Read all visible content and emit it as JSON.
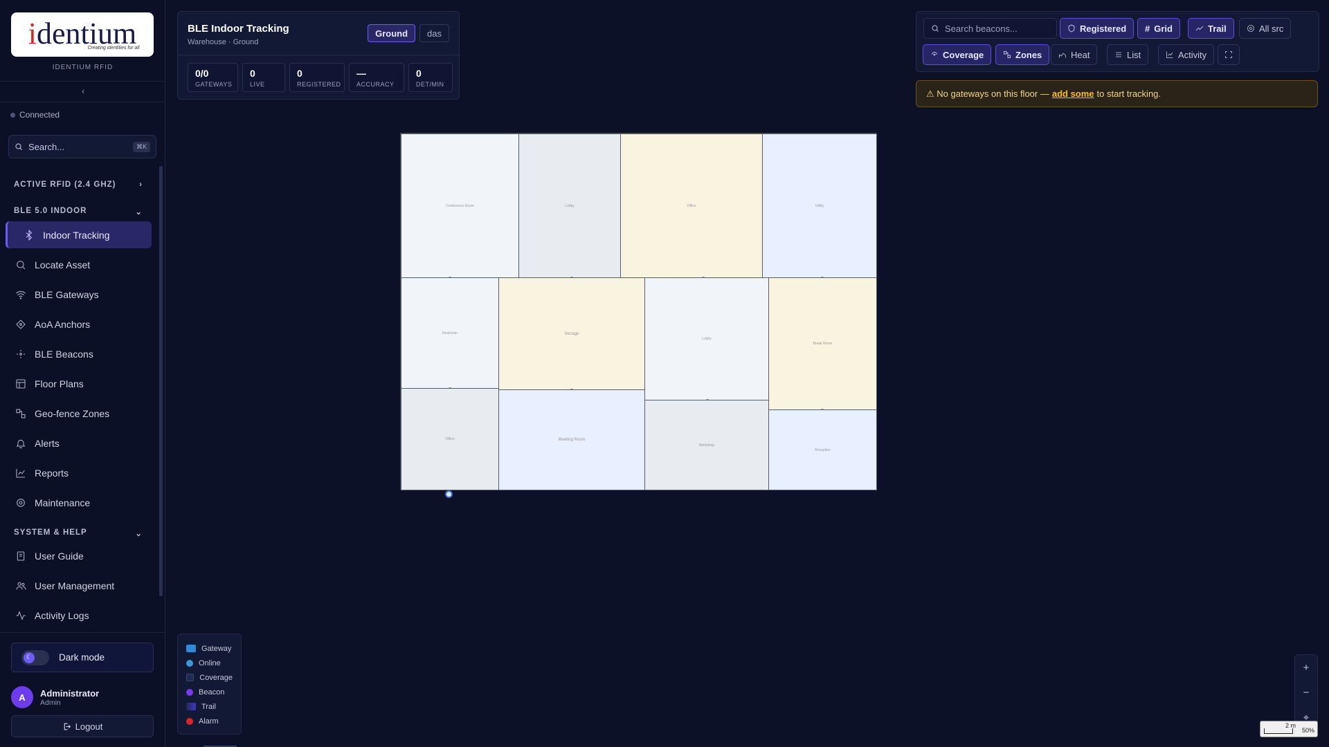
{
  "brand": {
    "logo_text": "identium",
    "logo_tagline": "Creating identities for all",
    "name": "IDENTIUM RFID"
  },
  "sidebar": {
    "connection": "Connected",
    "search_placeholder": "Search...",
    "search_shortcut": "⌘K",
    "sections": [
      {
        "label": "ACTIVE RFID (2.4 GHZ)"
      },
      {
        "label": "BLE 5.0 INDOOR"
      },
      {
        "label": "SYSTEM & HELP"
      }
    ],
    "items": [
      {
        "label": "Indoor Tracking",
        "icon": "bluetooth-icon"
      },
      {
        "label": "Locate Asset",
        "icon": "search-icon"
      },
      {
        "label": "BLE Gateways",
        "icon": "wifi-icon"
      },
      {
        "label": "AoA Anchors",
        "icon": "diamond-icon"
      },
      {
        "label": "BLE Beacons",
        "icon": "beacon-icon"
      },
      {
        "label": "Floor Plans",
        "icon": "layout-icon"
      },
      {
        "label": "Geo-fence Zones",
        "icon": "zones-icon"
      },
      {
        "label": "Alerts",
        "icon": "bell-icon"
      },
      {
        "label": "Reports",
        "icon": "chart-icon"
      },
      {
        "label": "Maintenance",
        "icon": "gear-icon"
      },
      {
        "label": "User Guide",
        "icon": "book-icon"
      },
      {
        "label": "User Management",
        "icon": "users-icon"
      },
      {
        "label": "Activity Logs",
        "icon": "activity-icon"
      }
    ],
    "dark_mode_label": "Dark mode",
    "user": {
      "initial": "A",
      "name": "Administrator",
      "role": "Admin"
    },
    "logout_label": "Logout"
  },
  "header": {
    "title": "BLE Indoor Tracking",
    "subtitle": "Warehouse · Ground",
    "floors": [
      "Ground",
      "das"
    ],
    "stats": [
      {
        "value": "0/0",
        "label": "GATEWAYS"
      },
      {
        "value": "0",
        "label": "LIVE"
      },
      {
        "value": "0",
        "label": "REGISTERED"
      },
      {
        "value": "—",
        "label": "ACCURACY"
      },
      {
        "value": "0",
        "label": "DET/MIN"
      }
    ]
  },
  "toolbar": {
    "search_placeholder": "Search beacons...",
    "buttons": [
      {
        "label": "Registered",
        "icon": "shield-icon",
        "active": true
      },
      {
        "label": "Grid",
        "icon": "hash-icon",
        "active": true
      },
      {
        "label": "Trail",
        "icon": "trail-icon",
        "active": true
      },
      {
        "label": "All src",
        "icon": "target-icon",
        "active": false
      },
      {
        "label": "Coverage",
        "icon": "coverage-icon",
        "active": true
      },
      {
        "label": "Zones",
        "icon": "zones-icon",
        "active": true
      },
      {
        "label": "Heat",
        "icon": "heat-icon",
        "active": false
      },
      {
        "label": "List",
        "icon": "list-icon",
        "active": false
      },
      {
        "label": "Activity",
        "icon": "activity-icon",
        "active": false
      }
    ]
  },
  "warning": {
    "prefix": "⚠ No gateways on this floor —",
    "link": "add some",
    "suffix": "to start tracking."
  },
  "map": {
    "zones": [
      {
        "label": "Conference Room",
        "color": "#f1f4f8"
      },
      {
        "label": "Lobby",
        "color": "#e8ebef"
      },
      {
        "label": "Office",
        "color": "#f8f4e0"
      },
      {
        "label": "Utility",
        "color": "#e8efff"
      },
      {
        "label": "Restroom",
        "color": "#f1f4f8"
      },
      {
        "label": "Storage",
        "color": "#f8f4e0"
      },
      {
        "label": "Lobby",
        "color": "#f1f4f8"
      },
      {
        "label": "Break Room",
        "color": "#f8f4e0"
      },
      {
        "label": "Office",
        "color": "#e8ebef"
      },
      {
        "label": "Meeting Room",
        "color": "#e8efff"
      },
      {
        "label": "Workshop",
        "color": "#e8ebef"
      },
      {
        "label": "Reception",
        "color": "#e8efff"
      }
    ]
  },
  "legend": [
    {
      "label": "Gateway",
      "color": "#2e8bd6",
      "shape": "square"
    },
    {
      "label": "Online",
      "color": "#3b95db",
      "shape": "dot"
    },
    {
      "label": "Coverage",
      "color": "#1e2a50",
      "shape": "square"
    },
    {
      "label": "Beacon",
      "color": "#7c3aed",
      "shape": "dot"
    },
    {
      "label": "Trail",
      "color": "#4338ca",
      "shape": "square"
    },
    {
      "label": "Alarm",
      "color": "#dc2626",
      "shape": "dot"
    }
  ],
  "zoom": {
    "scale": "2 m",
    "level": "50%"
  }
}
